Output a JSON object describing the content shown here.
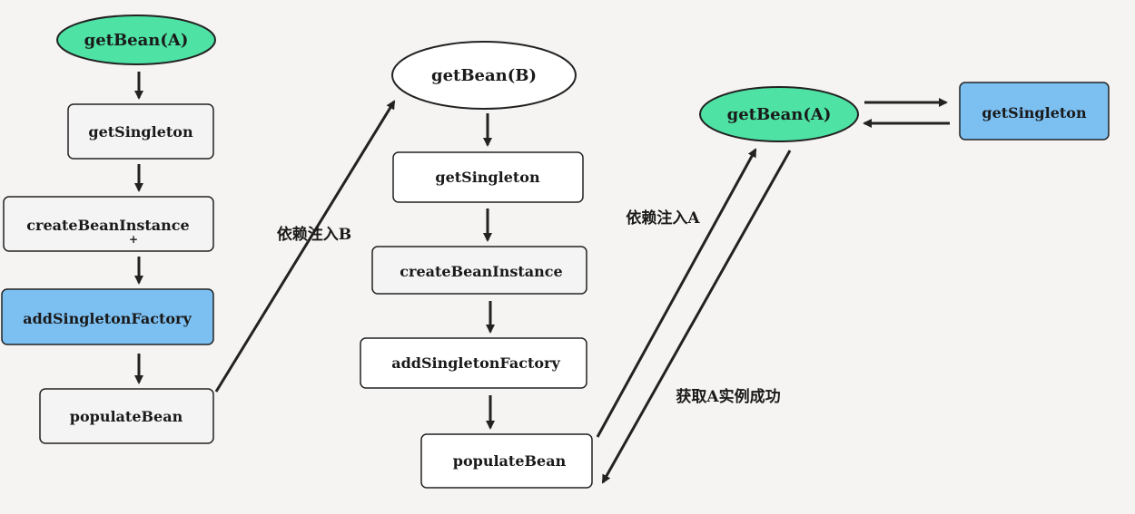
{
  "colors": {
    "background": "#f6f4f2",
    "ellipse_green": "#4ee2a4",
    "box_blue": "#7cc0f2",
    "box_default": "#f4f4f4",
    "stroke": "#222222"
  },
  "column_a": {
    "start": "getBean(A)",
    "get_singleton": "getSingleton",
    "create_instance": "createBeanInstance",
    "add_factory": "addSingletonFactory",
    "populate": "populateBean"
  },
  "column_b": {
    "start": "getBean(B)",
    "get_singleton": "getSingleton",
    "create_instance": "createBeanInstance",
    "add_factory": "addSingletonFactory",
    "populate": "populateBean"
  },
  "column_c": {
    "start": "getBean(A)",
    "get_singleton": "getSingleton"
  },
  "edge_labels": {
    "inject_b": "依赖注入B",
    "inject_a": "依赖注入A",
    "get_a_success": "获取A实例成功"
  }
}
